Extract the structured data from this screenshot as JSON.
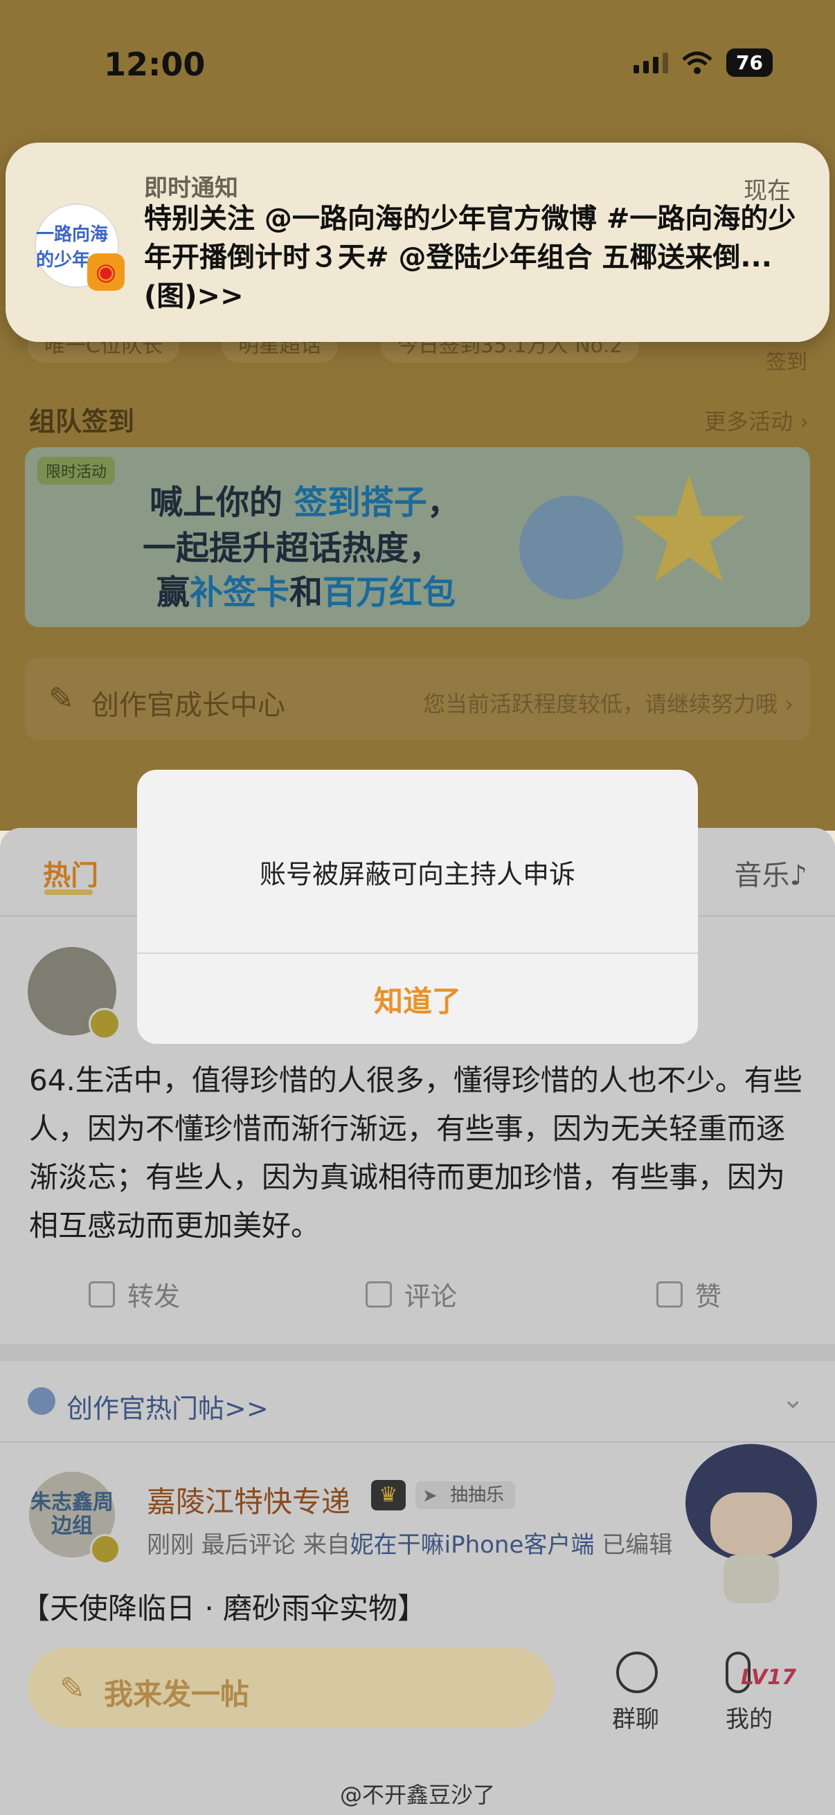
{
  "status_bar": {
    "time": "12:00",
    "battery": "76"
  },
  "notification": {
    "app": "即时通知",
    "time": "现在",
    "body": "特别关注 @一路向海的少年官方微博 #一路向海的少年开播倒计时３天# @登陆少年组合 五椰送来倒...(图)>>",
    "avatar_text": "一路向海的少年"
  },
  "behind_row": {
    "chips": [
      "唯一C位队长",
      "明星超话",
      "今日签到35.1万人 No.2"
    ],
    "sign": "签到"
  },
  "team_signin": {
    "title": "组队签到",
    "more": "更多活动 ›"
  },
  "banner": {
    "tag": "限时活动",
    "line1": "喊上你的 ",
    "line1_hl": "签到搭子",
    "line1_end": "，",
    "line2": "一起提升超话热度，",
    "line3_a": "赢",
    "line3_hl1": "补签卡",
    "line3_b": "和",
    "line3_hl2": "百万红包"
  },
  "growth": {
    "title": "创作官成长中心",
    "note": "您当前活跃程度较低，请继续努力哦 ›"
  },
  "tabs": {
    "hot": "热门",
    "music": "音乐♪"
  },
  "post1": {
    "text": "64.生活中，值得珍惜的人很多，懂得珍惜的人也不少。有些人，因为不懂珍惜而渐行渐远，有些事，因为无关轻重而逐渐淡忘；有些人，因为真诚相待而更加珍惜，有些事，因为相互感动而更加美好。"
  },
  "actions": {
    "repost": "转发",
    "comment": "评论",
    "like": "赞"
  },
  "creator_section": {
    "title": "创作官热门帖>>",
    "chevron": "⌄"
  },
  "post2": {
    "avatar_text": "朱志鑫周边组",
    "user": "嘉陵江特快专递",
    "tag": "抽抽乐",
    "meta_a": "刚刚  最后评论  来自",
    "meta_src": "妮在干嘛iPhone客户端",
    "meta_b": "  已编辑",
    "title": "【天使降临日 · 磨砂雨伞实物】"
  },
  "bottom": {
    "compose": "我来发一帖",
    "group": "群聊",
    "me": "我的",
    "lv": "LV17"
  },
  "dialog": {
    "message": "账号被屏蔽可向主持人申诉",
    "button": "知道了"
  },
  "watermark": "@不开鑫豆沙了"
}
